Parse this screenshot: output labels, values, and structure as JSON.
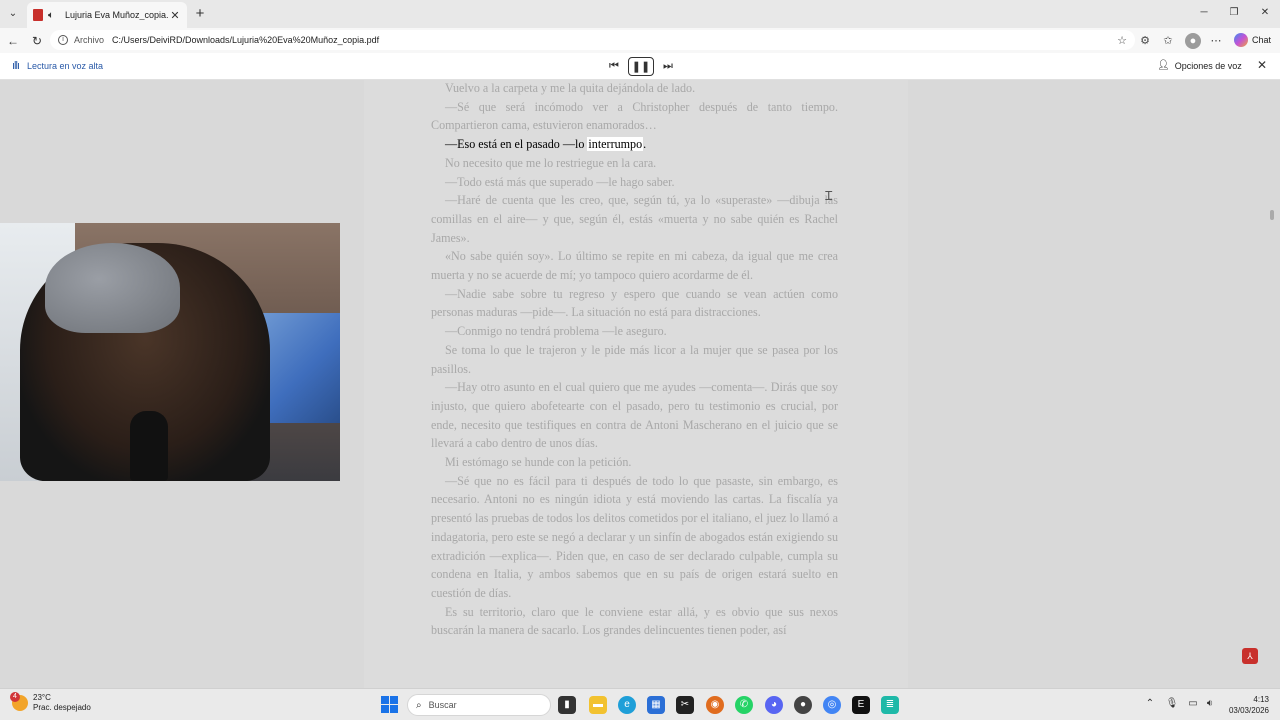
{
  "browser": {
    "tab_title": "Lujuria Eva Muñoz_copia.pdf",
    "tab_close": "✕",
    "new_tab": "+",
    "address_label": "Archivo",
    "url": "C:/Users/DeiviRD/Downloads/Lujuria%20Eva%20Muñoz_copia.pdf",
    "chat_label": "Chat"
  },
  "read_aloud": {
    "label": "Lectura en voz alta",
    "voice_options": "Opciones de voz"
  },
  "document": {
    "paragraphs": [
      {
        "text": "Vuelvo a la carpeta y me la quita dejándola de lado.",
        "indent": true
      },
      {
        "text": "—Sé que será incómodo ver a Christopher después de tanto tiempo. Compartieron cama, estuvieron enamorados…",
        "indent": true
      },
      {
        "before": "—Eso está en el pasado —lo ",
        "highlight": "interrumpo",
        "after": ".",
        "indent": true,
        "active": true
      },
      {
        "text": "No necesito que me lo restriegue en la cara.",
        "indent": true
      },
      {
        "text": "—Todo está más que superado —le hago saber.",
        "indent": true
      },
      {
        "text": "—Haré de cuenta que les creo, que, según tú, ya lo «superaste» —dibuja las comillas en el aire— y que, según él, estás «muerta y no sabe quién es Rachel James».",
        "indent": true
      },
      {
        "text": "«No sabe quién soy». Lo último se repite en mi cabeza, da igual que me crea muerta y no se acuerde de mí; yo tampoco quiero acordarme de él.",
        "indent": true
      },
      {
        "text": "—Nadie sabe sobre tu regreso y espero que cuando se vean actúen como personas maduras —pide—. La situación no está para distracciones.",
        "indent": true
      },
      {
        "text": "—Conmigo no tendrá problema —le aseguro.",
        "indent": true
      },
      {
        "text": "Se toma lo que le trajeron y le pide más licor a la mujer que se pasea por los pasillos.",
        "indent": true
      },
      {
        "text": "—Hay otro asunto en el cual quiero que me ayudes —comenta—. Dirás que soy injusto, que quiero abofetearte con el pasado, pero tu testimonio es crucial, por ende, necesito que testifiques en contra de Antoni Mascherano en el juicio que se llevará a cabo dentro de unos días.",
        "indent": true
      },
      {
        "text": "Mi estómago se hunde con la petición.",
        "indent": true
      },
      {
        "text": "—Sé que no es fácil para ti después de todo lo que pasaste, sin embargo, es necesario. Antoni no es ningún idiota y está moviendo las cartas. La fiscalía ya presentó las pruebas de todos los delitos cometidos por el italiano, el juez lo llamó a indagatoria, pero este se negó a declarar y un sinfín de abogados están exigiendo su extradición —explica—. Piden que, en caso de ser declarado culpable, cumpla su condena en Italia, y ambos sabemos que en su país de origen estará suelto en cuestión de días.",
        "indent": true
      },
      {
        "text": "Es su territorio, claro que le conviene estar allá, y es obvio que sus nexos buscarán la manera de sacarlo. Los grandes delincuentes tienen poder, así",
        "indent": true
      }
    ]
  },
  "taskbar": {
    "weather_temp": "23°C",
    "weather_desc": "Prac. despejado",
    "weather_badge": "4",
    "search_placeholder": "Buscar",
    "time": "4:13",
    "date": "03/03/2026"
  },
  "colors": {
    "read_accent": "#2a5aa8",
    "pdf_red": "#c8302c",
    "start_blue": "#1a73e8"
  }
}
